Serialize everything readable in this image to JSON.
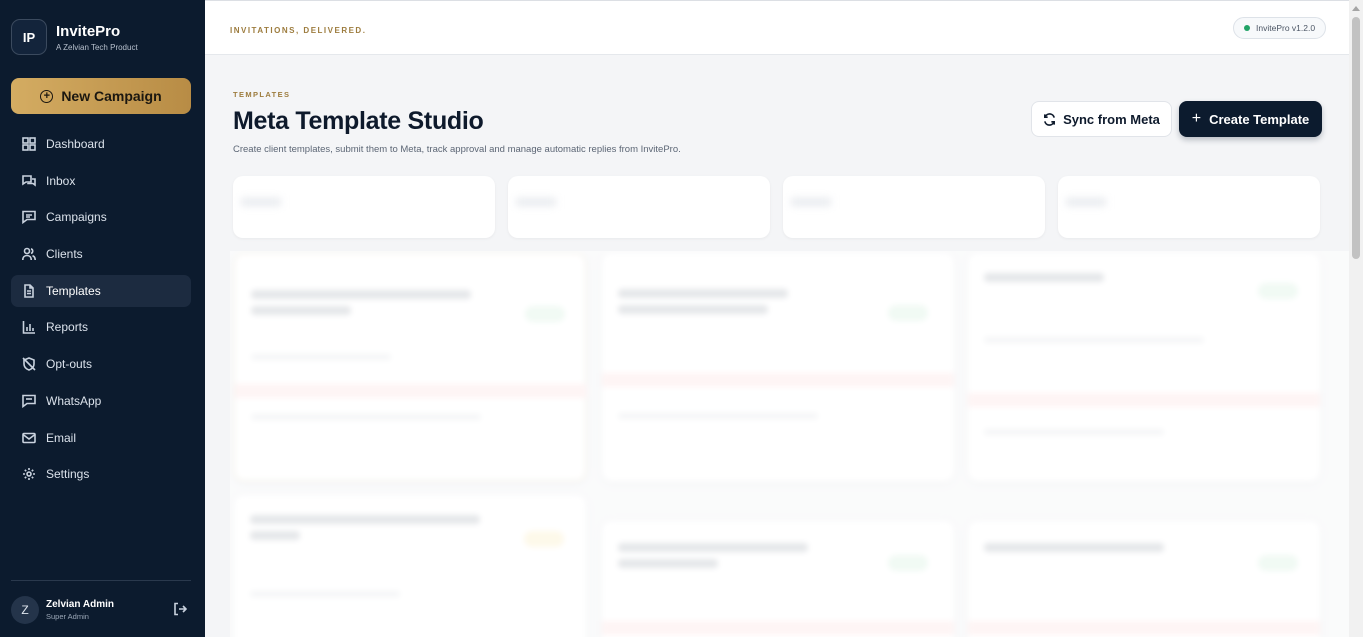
{
  "brand": {
    "logo_text": "IP",
    "name": "InvitePro",
    "subtitle": "A Zelvian Tech Product"
  },
  "new_campaign_label": "New Campaign",
  "nav": {
    "items": [
      {
        "label": "Dashboard",
        "icon": "grid-icon"
      },
      {
        "label": "Inbox",
        "icon": "chat-icon"
      },
      {
        "label": "Campaigns",
        "icon": "message-icon"
      },
      {
        "label": "Clients",
        "icon": "users-icon"
      },
      {
        "label": "Templates",
        "icon": "file-icon",
        "active": true
      },
      {
        "label": "Reports",
        "icon": "bar-chart-icon"
      },
      {
        "label": "Opt-outs",
        "icon": "shield-off-icon"
      },
      {
        "label": "WhatsApp",
        "icon": "message-square-icon"
      },
      {
        "label": "Email",
        "icon": "mail-icon"
      },
      {
        "label": "Settings",
        "icon": "gear-icon"
      }
    ]
  },
  "user": {
    "initial": "Z",
    "name": "Zelvian Admin",
    "role": "Super Admin"
  },
  "topbar": {
    "tagline": "INVITATIONS, DELIVERED.",
    "version": "InvitePro v1.2.0"
  },
  "page": {
    "eyebrow": "TEMPLATES",
    "title": "Meta Template Studio",
    "subtitle": "Create client templates, submit them to Meta, track approval and manage automatic replies from InvitePro.",
    "sync_label": "Sync from Meta",
    "create_label": "Create Template"
  },
  "colors": {
    "sidebar_bg": "#0c1b2e",
    "accent_gold": "#c9a059",
    "primary_dark": "#0c1b2e",
    "status_green": "#21a366"
  }
}
